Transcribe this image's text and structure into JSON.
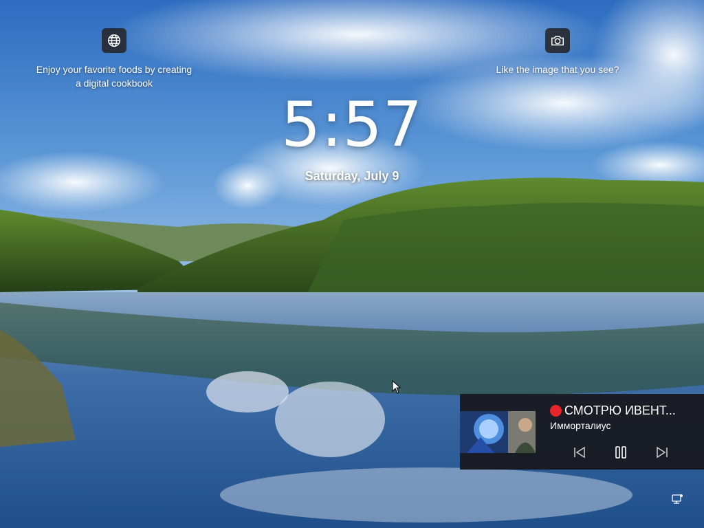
{
  "lock_screen": {
    "time": "5:57",
    "date": "Saturday, July 9"
  },
  "widgets": {
    "left": {
      "icon": "globe-icon",
      "text_line1": "Enjoy your favorite foods by creating",
      "text_line2": "a digital cookbook"
    },
    "right": {
      "icon": "camera-icon",
      "text": "Like the image that you see?"
    }
  },
  "media": {
    "title": "СМОТРЮ ИВЕНТ...",
    "artist": "Имморталиус",
    "controls": [
      "previous-track-icon",
      "pause-icon",
      "next-track-icon"
    ],
    "live_dot_color": "#e8262a"
  },
  "system_tray": {
    "icon": "network-icon"
  }
}
